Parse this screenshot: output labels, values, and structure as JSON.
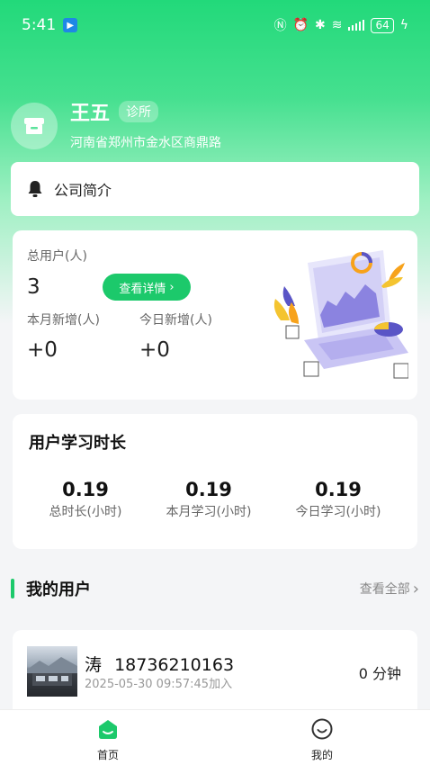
{
  "status_bar": {
    "time": "5:41",
    "battery": "64"
  },
  "profile": {
    "name": "王五",
    "role": "诊所",
    "address": "河南省郑州市金水区商鼎路"
  },
  "intro": {
    "label": "公司简介"
  },
  "stats": {
    "total_users_label": "总用户(人)",
    "total_users_value": "3",
    "detail_button": "查看详情",
    "month_new_label": "本月新增(人)",
    "month_new_value": "+0",
    "today_new_label": "今日新增(人)",
    "today_new_value": "+0"
  },
  "study": {
    "title": "用户学习时长",
    "items": [
      {
        "value": "0.19",
        "label": "总时长(小时)"
      },
      {
        "value": "0.19",
        "label": "本月学习(小时)"
      },
      {
        "value": "0.19",
        "label": "今日学习(小时)"
      }
    ]
  },
  "my_users": {
    "title": "我的用户",
    "view_all": "查看全部",
    "items": [
      {
        "name": "涛",
        "phone": "18736210163",
        "joined": "2025-05-30 09:57:45加入",
        "duration": "0 分钟"
      }
    ]
  },
  "tabs": [
    {
      "label": "首页",
      "icon": "home-icon",
      "active": true
    },
    {
      "label": "我的",
      "icon": "smile-icon",
      "active": false
    }
  ],
  "colors": {
    "accent": "#1cc96b",
    "header_green": "#22d97a"
  }
}
